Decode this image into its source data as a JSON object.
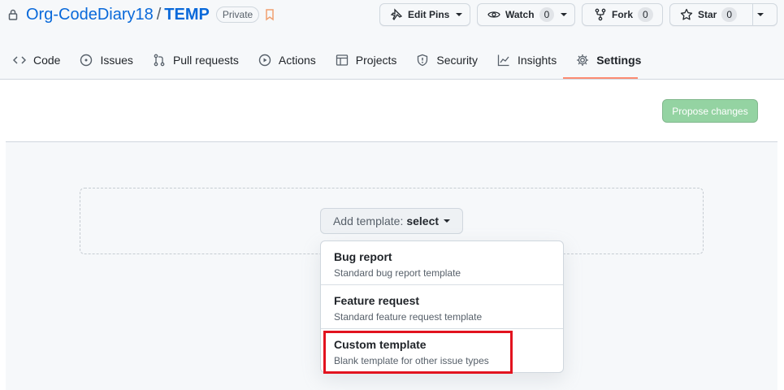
{
  "repo": {
    "org": "Org-CodeDiary18",
    "separator": "/",
    "name": "TEMP",
    "visibility": "Private"
  },
  "header_actions": {
    "edit_pins": "Edit Pins",
    "watch": "Watch",
    "watch_count": "0",
    "fork": "Fork",
    "fork_count": "0",
    "star": "Star",
    "star_count": "0"
  },
  "tabs": [
    {
      "label": "Code",
      "icon": "code-icon"
    },
    {
      "label": "Issues",
      "icon": "issue-icon"
    },
    {
      "label": "Pull requests",
      "icon": "pull-request-icon"
    },
    {
      "label": "Actions",
      "icon": "play-icon"
    },
    {
      "label": "Projects",
      "icon": "table-icon"
    },
    {
      "label": "Security",
      "icon": "shield-icon"
    },
    {
      "label": "Insights",
      "icon": "graph-icon"
    },
    {
      "label": "Settings",
      "icon": "gear-icon",
      "active": true
    }
  ],
  "content": {
    "propose_changes": "Propose changes",
    "add_template_label": "Add template:",
    "add_template_value": "select"
  },
  "template_menu": [
    {
      "title": "Bug report",
      "description": "Standard bug report template"
    },
    {
      "title": "Feature request",
      "description": "Standard feature request template"
    },
    {
      "title": "Custom template",
      "description": "Blank template for other issue types"
    }
  ],
  "colors": {
    "link": "#0969da",
    "tab_underline": "#fd8c73",
    "propose_button": "#94d3a2",
    "highlight": "#e2131f"
  }
}
